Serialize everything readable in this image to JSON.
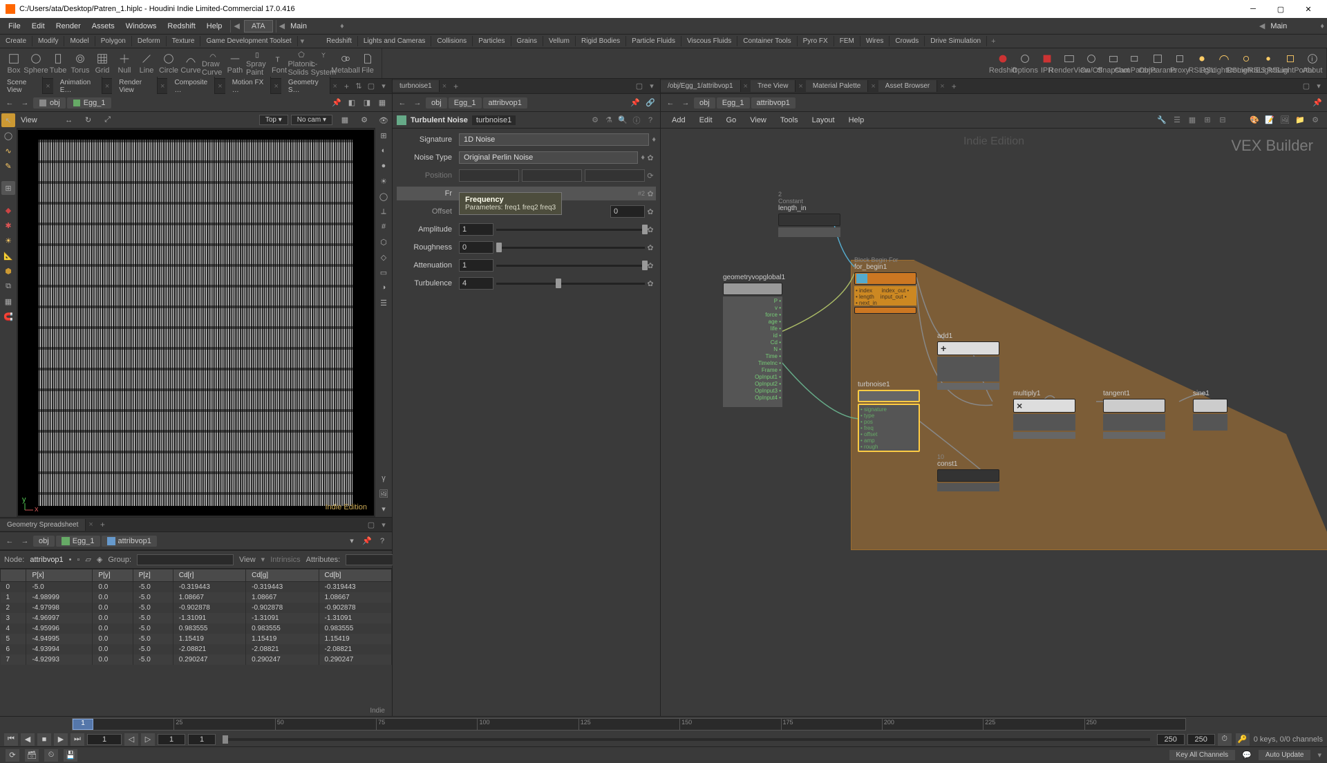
{
  "window": {
    "title": "C:/Users/ata/Desktop/Patren_1.hiplc - Houdini Indie Limited-Commercial 17.0.416"
  },
  "menubar": [
    "File",
    "Edit",
    "Render",
    "Assets",
    "Windows",
    "Redshift",
    "Help"
  ],
  "desktops": {
    "left": "ATA",
    "right": "Main"
  },
  "main_dropdown": "Main",
  "right_desktop": "Main",
  "shelf_tabs_left": [
    "Create",
    "Modify",
    "Model",
    "Polygon",
    "Deform",
    "Texture",
    "Game Development Toolset"
  ],
  "shelf_tabs_right": [
    "Redshift",
    "Lights and Cameras",
    "Collisions",
    "Particles",
    "Grains",
    "Vellum",
    "Rigid Bodies",
    "Particle Fluids",
    "Viscous Fluids",
    "Container Tools",
    "Pyro FX",
    "FEM",
    "Wires",
    "Crowds",
    "Drive Simulation"
  ],
  "shelf_left": [
    "Box",
    "Sphere",
    "Tube",
    "Torus",
    "Grid",
    "Null",
    "Line",
    "Circle",
    "Curve",
    "Draw Curve",
    "Path",
    "Spray Paint",
    "Font",
    "Platonic Solids",
    "L-System",
    "Metaball",
    "File"
  ],
  "shelf_right": [
    "Redshift",
    "Options",
    "IPR",
    "RenderView",
    "On/Off",
    "Snapshot",
    "CamParams",
    "ObjParams",
    "Proxy",
    "RSLight",
    "RSLightDome",
    "RSLightIES",
    "RSLightSun",
    "RSLightPortal",
    "About"
  ],
  "tabs": {
    "scene": [
      "Scene View",
      "Animation E…",
      "Render View",
      "Composite …",
      "Motion FX …",
      "Geometry S…"
    ],
    "parm": "turbnoise1",
    "net": [
      "/obj/Egg_1/attribvop1",
      "Tree View",
      "Material Palette",
      "Asset Browser"
    ],
    "spread": "Geometry Spreadsheet"
  },
  "path": {
    "obj": "obj",
    "geo": "Egg_1",
    "vop": "attribvop1"
  },
  "viewport": {
    "label": "View",
    "top": "Top ▾",
    "cam": "No cam ▾",
    "watermark": "Indie Edition"
  },
  "parm": {
    "op_type": "Turbulent Noise",
    "op_name": "turbnoise1",
    "signature_lbl": "Signature",
    "signature": "1D Noise",
    "type_lbl": "Noise Type",
    "type": "Original Perlin Noise",
    "pos_lbl": "Position",
    "freq_lbl": "Frequency",
    "off_lbl": "Offset",
    "off": "0",
    "amp_lbl": "Amplitude",
    "amp": "1",
    "rough_lbl": "Roughness",
    "rough": "0",
    "atten_lbl": "Attenuation",
    "atten": "1",
    "turb_lbl": "Turbulence",
    "turb": "4",
    "tooltip_title": "Frequency",
    "tooltip_sub": "Parameters: freq1 freq2 freq3"
  },
  "vex": {
    "menu": [
      "Add",
      "Edit",
      "Go",
      "View",
      "Tools",
      "Layout",
      "Help"
    ],
    "title": "VEX Builder",
    "watermark": "Indie Edition",
    "nodes": {
      "length_in": {
        "label": "length_in",
        "sub": "Constant",
        "num": "2"
      },
      "global": {
        "label": "geometryvopglobal1"
      },
      "for_begin": {
        "label": "for_begin1",
        "sub": "Block Begin For"
      },
      "add": {
        "label": "add1"
      },
      "turb": {
        "label": "turbnoise1"
      },
      "mult": {
        "label": "multiply1"
      },
      "tan": {
        "label": "tangent1"
      },
      "sine": {
        "label": "sine1"
      },
      "const": {
        "label": "const1",
        "num": "10"
      }
    }
  },
  "ss": {
    "node_lbl": "Node:",
    "node": "attribvop1",
    "group_lbl": "Group:",
    "view_lbl": "View",
    "intr_lbl": "Intrinsics",
    "attr_lbl": "Attributes:",
    "cols": [
      "",
      "P[x]",
      "P[y]",
      "P[z]",
      "Cd[r]",
      "Cd[g]",
      "Cd[b]"
    ],
    "rows": [
      [
        "0",
        "-5.0",
        "0.0",
        "-5.0",
        "-0.319443",
        "-0.319443",
        "-0.319443"
      ],
      [
        "1",
        "-4.98999",
        "0.0",
        "-5.0",
        "1.08667",
        "1.08667",
        "1.08667"
      ],
      [
        "2",
        "-4.97998",
        "0.0",
        "-5.0",
        "-0.902878",
        "-0.902878",
        "-0.902878"
      ],
      [
        "3",
        "-4.96997",
        "0.0",
        "-5.0",
        "-1.31091",
        "-1.31091",
        "-1.31091"
      ],
      [
        "4",
        "-4.95996",
        "0.0",
        "-5.0",
        "0.983555",
        "0.983555",
        "0.983555"
      ],
      [
        "5",
        "-4.94995",
        "0.0",
        "-5.0",
        "1.15419",
        "1.15419",
        "1.15419"
      ],
      [
        "6",
        "-4.93994",
        "0.0",
        "-5.0",
        "-2.08821",
        "-2.08821",
        "-2.08821"
      ],
      [
        "7",
        "-4.92993",
        "0.0",
        "-5.0",
        "0.290247",
        "0.290247",
        "0.290247"
      ]
    ],
    "footer": "Indie"
  },
  "timeline": {
    "cur": "1",
    "start": "1",
    "startv": "1",
    "end": "250",
    "endv": "250",
    "ticks": [
      "",
      "25",
      "50",
      "75",
      "100",
      "125",
      "150",
      "175",
      "200",
      "225",
      "250"
    ],
    "keys": "0 keys, 0/0 channels",
    "channels": "Key All Channels"
  },
  "status": {
    "auto": "Auto Update"
  }
}
